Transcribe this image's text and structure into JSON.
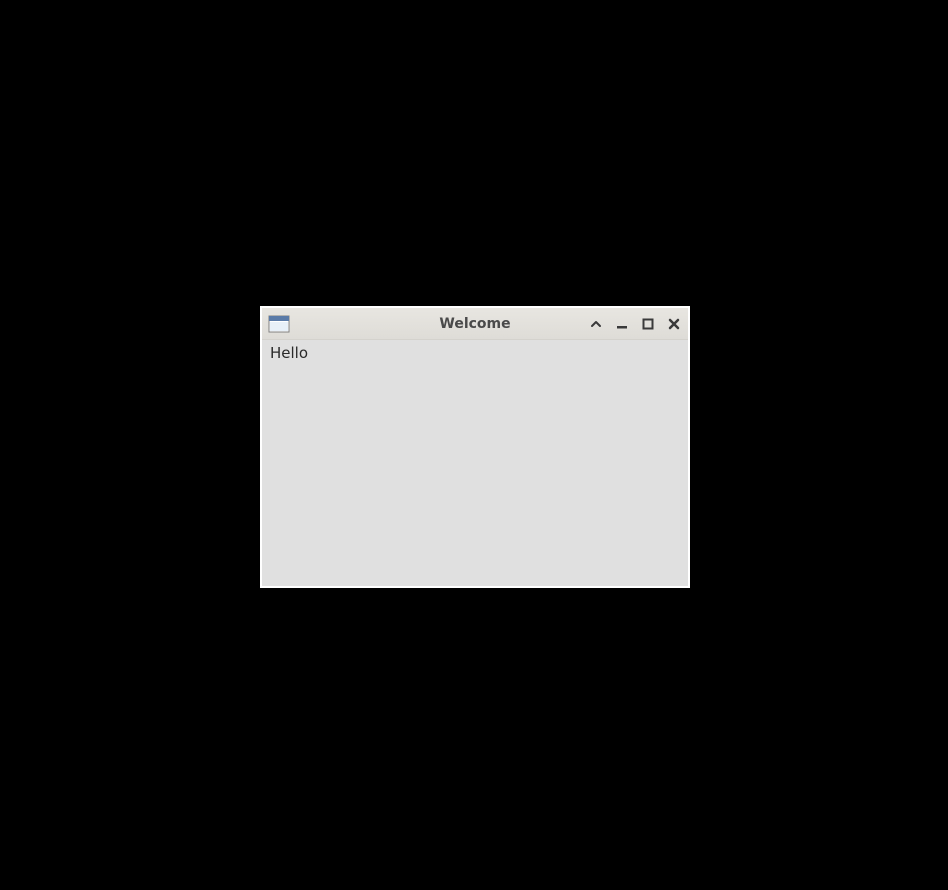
{
  "window": {
    "title": "Welcome",
    "content": "Hello"
  }
}
